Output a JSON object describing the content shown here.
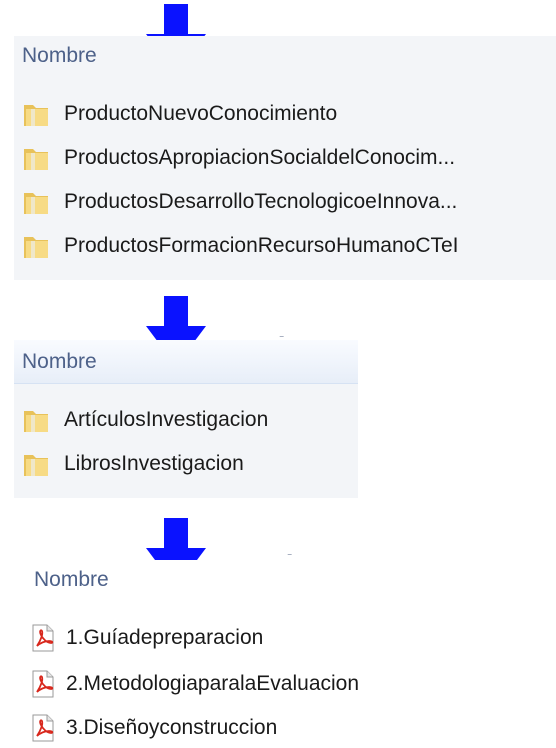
{
  "colors": {
    "arrow": "#0a12ff",
    "header_text": "#4d6189",
    "panel_bg": "#f3f5f8"
  },
  "panels": [
    {
      "header": "Nombre",
      "items": [
        {
          "icon": "folder-icon",
          "label": "ProductoNuevoConocimiento"
        },
        {
          "icon": "folder-icon",
          "label": "ProductosApropiacionSocialdelConocim..."
        },
        {
          "icon": "folder-icon",
          "label": "ProductosDesarrolloTecnologicoeInnova..."
        },
        {
          "icon": "folder-icon",
          "label": "ProductosFormacionRecursoHumanoCTeI"
        }
      ]
    },
    {
      "header": "Nombre",
      "items": [
        {
          "icon": "folder-icon",
          "label": "ArtículosInvestigacion"
        },
        {
          "icon": "folder-icon",
          "label": "LibrosInvestigacion"
        }
      ]
    },
    {
      "header": "Nombre",
      "items": [
        {
          "icon": "pdf-icon",
          "label": "1.Guíadepreparacion"
        },
        {
          "icon": "pdf-icon",
          "label": "2.MetodologiaparalaEvaluacion"
        },
        {
          "icon": "pdf-icon",
          "label": "3.Diseñoyconstruccion"
        }
      ]
    }
  ]
}
